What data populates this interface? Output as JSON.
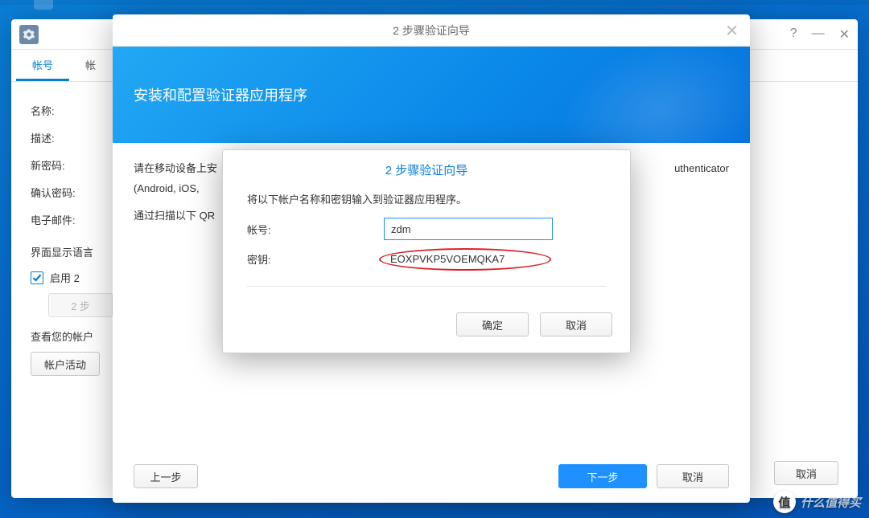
{
  "settings": {
    "tab_active": "帐号",
    "tab_other_prefix": "帐",
    "labels": {
      "name": "名称:",
      "desc": "描述:",
      "new_password": "新密码:",
      "confirm_password": "确认密码:",
      "email": "电子邮件:",
      "display_lang": "界面显示语言"
    },
    "enable2fa": "启用 2",
    "btn_2step_prefix": "2 步",
    "view_account_prefix": "查看您的帐户",
    "btn_account_activity": "帐户活动",
    "btn_cancel": "取消"
  },
  "wizard": {
    "title": "2 步骤验证向导",
    "header": "安装和配置验证器应用程序",
    "body_line1": "请在移动设备上安",
    "body_line1_tail": "uthenticator",
    "body_line2_prefix": "(Android, iOS,",
    "body_line3": "通过扫描以下 QR",
    "btn_prev": "上一步",
    "btn_next": "下一步",
    "btn_cancel": "取消"
  },
  "dialog": {
    "title": "2 步骤验证向导",
    "instruction": "将以下帐户名称和密钥输入到验证器应用程序。",
    "label_account": "帐号:",
    "value_account": "zdm",
    "label_key": "密钥:",
    "value_key": "EOXPVKP5VOEMQKA7",
    "btn_ok": "确定",
    "btn_cancel": "取消"
  },
  "watermark": {
    "icon": "值",
    "text": "什么值得买"
  }
}
